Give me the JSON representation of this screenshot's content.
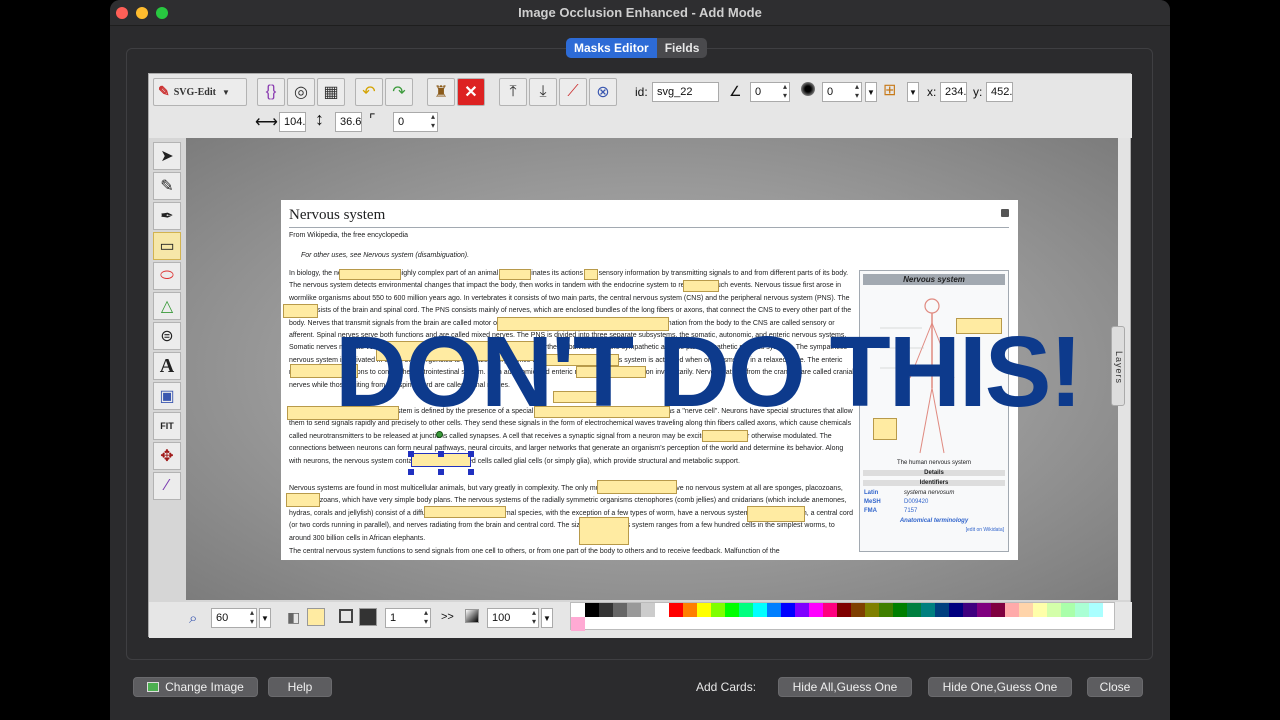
{
  "window": {
    "title": "Image Occlusion Enhanced - Add Mode"
  },
  "tabs": [
    {
      "label": "Masks Editor",
      "active": true
    },
    {
      "label": "Fields",
      "active": false
    }
  ],
  "toolbar": {
    "svg_edit_label": "SVG-Edit",
    "id_label": "id:",
    "id_value": "svg_22",
    "angle_value": "0",
    "blur_value": "0",
    "x_label": "x:",
    "x_value": "234.",
    "y_label": "y:",
    "y_value": "452.",
    "width_value": "104.",
    "height_value": "36.6",
    "radius_value": "0"
  },
  "bottom": {
    "zoom_value": "60",
    "stroke_width": "1",
    "opacity": "100",
    "arrows": ">>"
  },
  "layers_label": "Layers",
  "wiki": {
    "title": "Nervous system",
    "subtitle": "From Wikipedia, the free encyclopedia",
    "hatnote": "For other uses, see Nervous system (disambiguation).",
    "para1": "In biology, the nervous system is a highly complex part of an animal that coordinates its actions and sensory information by transmitting signals to and from different parts of its body. The nervous system detects environmental changes that impact the body, then works in tandem with the endocrine system to respond to such events. Nervous tissue first arose in wormlike organisms about 550 to 600 million years ago. In vertebrates it consists of two main parts, the central nervous system (CNS) and the peripheral nervous system (PNS). The CNS consists of the brain and spinal cord. The PNS consists mainly of nerves, which are enclosed bundles of the long fibers or axons, that connect the CNS to every other part of the body. Nerves that transmit signals from the brain are called motor or efferent nerves, while those nerves that transmit information from the body to the CNS are called sensory or afferent. Spinal nerves serve both functions and are called mixed nerves. The PNS is divided into three separate subsystems, the somatic, autonomic, and enteric nervous systems. Somatic nerves mediate voluntary movement. The autonomic nervous system is further subdivided into the sympathetic and the parasympathetic nervous systems. The sympathetic nervous system is activated in cases of emergencies to mobilize energy, while the parasympathetic nervous system is activated when organisms are in a relaxed state. The enteric nervous system functions to control the gastrointestinal system. Both autonomic and enteric nervous systems function involuntarily. Nerves that exit from the cranium are called cranial nerves while those exiting from the spinal cord are called spinal nerves.",
    "para2": "At the cellular level, the nervous system is defined by the presence of a special type of cell, called the neuron, also known as a \"nerve cell\". Neurons have special structures that allow them to send signals rapidly and precisely to other cells. They send these signals in the form of electrochemical waves traveling along thin fibers called axons, which cause chemicals called neurotransmitters to be released at junctions called synapses. A cell that receives a synaptic signal from a neuron may be excited, inhibited, or otherwise modulated. The connections between neurons can form neural pathways, neural circuits, and larger networks that generate an organism's perception of the world and determine its behavior. Along with neurons, the nervous system contains other specialized cells called glial cells (or simply glia), which provide structural and metabolic support.",
    "para3": "Nervous systems are found in most multicellular animals, but vary greatly in complexity. The only multicellular animals that have no nervous system at all are sponges, placozoans, and mesozoans, which have very simple body plans. The nervous systems of the radially symmetric organisms ctenophores (comb jellies) and cnidarians (which include anemones, hydras, corals and jellyfish) consist of a diffuse nerve net. All other animal species, with the exception of a few types of worm, have a nervous system containing a brain, a central cord (or two cords running in parallel), and nerves radiating from the brain and central cord. The size of the nervous system ranges from a few hundred cells in the simplest worms, to around 300 billion cells in African elephants.",
    "para4": "The central nervous system functions to send signals from one cell to others, or from one part of the body to others and to receive feedback. Malfunction of the",
    "infobox": {
      "title": "Nervous system",
      "caption": "The human nervous system",
      "details": "Details",
      "identifiers": "Identifiers",
      "rows": [
        {
          "k": "Latin",
          "v": "systema nervosum"
        },
        {
          "k": "MeSH",
          "v": "D009420"
        },
        {
          "k": "FMA",
          "v": "7157"
        }
      ],
      "terminology": "Anatomical terminology",
      "edit": "[edit on Wikidata]"
    }
  },
  "overlay_text": "DON'T DO THIS!",
  "footer": {
    "change_image": "Change Image",
    "help": "Help",
    "add_cards": "Add Cards:",
    "hide_all": "Hide All,Guess One",
    "hide_one": "Hide One,Guess One",
    "close": "Close"
  },
  "colors": {
    "accent": "#2d6bd6",
    "mask_fill": "#ffeba2",
    "overlay": "#0d3a8c"
  }
}
